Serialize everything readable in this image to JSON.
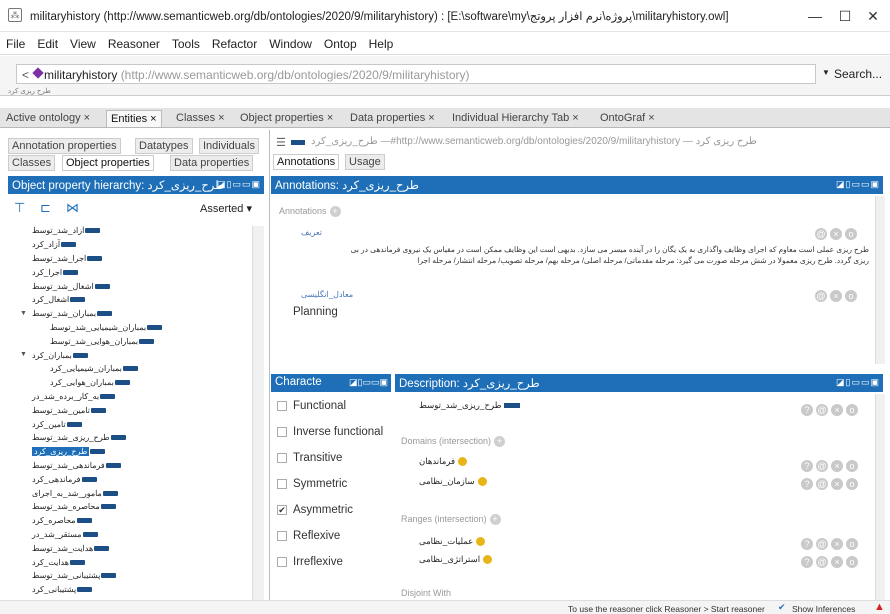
{
  "window": {
    "title": "militaryhistory (http://www.semanticweb.org/db/ontologies/2020/9/militaryhistory) : [E:\\software\\my\\پروژه\\نرم افزار پروتج\\militaryhistory.owl]",
    "minimize": "—",
    "maximize": "☐",
    "close": "✕"
  },
  "menu": [
    "File",
    "Edit",
    "View",
    "Reasoner",
    "Tools",
    "Refactor",
    "Window",
    "Ontop",
    "Help"
  ],
  "address": {
    "back": "<",
    "name": "militaryhistory",
    "iri": "(http://www.semanticweb.org/db/ontologies/2020/9/militaryhistory)",
    "search": "Search...",
    "breadcrumb": "طرح ریزی کرد"
  },
  "main_tabs": [
    "Active ontology ×",
    "Entities ×",
    "Classes ×",
    "Object properties ×",
    "Data properties ×",
    "Individual Hierarchy Tab ×",
    "OntoGraf ×"
  ],
  "left": {
    "subtabs_row1": [
      "Annotation properties",
      "Datatypes",
      "Individuals"
    ],
    "subtabs_row2": [
      "Classes",
      "Object properties",
      "Data properties"
    ],
    "header": "Object property hierarchy: طرح_ریزی_کرد",
    "header_buttons": "◪▯▭▭▣",
    "asserted": "Asserted ▾",
    "tree": [
      {
        "indent": 0,
        "label": "آزاد_شد_توسط"
      },
      {
        "indent": 0,
        "label": "آزاد_کرد"
      },
      {
        "indent": 0,
        "label": "اجرا_شد_توسط"
      },
      {
        "indent": 0,
        "label": "اجرا_کرد"
      },
      {
        "indent": 0,
        "label": "اشغال_شد_توسط"
      },
      {
        "indent": 0,
        "label": "اشغال_کرد"
      },
      {
        "indent": 0,
        "label": "بمباران_شد_توسط",
        "expanded": true
      },
      {
        "indent": 1,
        "label": "بمباران_شیمیایی_شد_توسط"
      },
      {
        "indent": 1,
        "label": "بمباران_هوایی_شد_توسط"
      },
      {
        "indent": 0,
        "label": "بمباران_کرد",
        "expanded": true
      },
      {
        "indent": 1,
        "label": "بمباران_شیمیایی_کرد"
      },
      {
        "indent": 1,
        "label": "بمباران_هوایی_کرد"
      },
      {
        "indent": 0,
        "label": "به_کار_برده_شد_در"
      },
      {
        "indent": 0,
        "label": "تامین_شد_توسط"
      },
      {
        "indent": 0,
        "label": "تامین_کرد"
      },
      {
        "indent": 0,
        "label": "طرح_ریزی_شد_توسط"
      },
      {
        "indent": 0,
        "label": "طرح_ریزی_کرد",
        "selected": true
      },
      {
        "indent": 0,
        "label": "فرماندهی_شد_توسط"
      },
      {
        "indent": 0,
        "label": "فرماندهی_کرد"
      },
      {
        "indent": 0,
        "label": "مامور_شد_به_اجرای"
      },
      {
        "indent": 0,
        "label": "محاصره_شد_توسط"
      },
      {
        "indent": 0,
        "label": "محاصره_کرد"
      },
      {
        "indent": 0,
        "label": "مستقر_شد_در"
      },
      {
        "indent": 0,
        "label": "هدایت_شد_توسط"
      },
      {
        "indent": 0,
        "label": "هدایت_کرد"
      },
      {
        "indent": 0,
        "label": "پشتیبانی_شد_توسط"
      },
      {
        "indent": 0,
        "label": "پشتیبانی_کرد"
      }
    ]
  },
  "right": {
    "iri_line": "طرح_ریزی_کرد —#http://www.semanticweb.org/db/ontologies/2020/9/militaryhistory — طرح ریزی کرد",
    "tabs": [
      "Annotations",
      "Usage"
    ],
    "annotations_header": "Annotations: طرح_ریزی_کرد",
    "header_buttons": "◪▯▭▭▣",
    "annotations_label": "Annotations",
    "ann1_prop": "تعریف",
    "ann1_text_line1": "طرح ریزی عملی است معاوم که اجرای وظایف واگذاری به یک یگان را در آینده میسر می سازد. بدیهی است این وظایف ممکن است در مقیاس یک نیروی فرماندهی در بی",
    "ann1_text_line2": "ریزی گردد. طرح ریزی معمولا در شش مرحله صورت می گیرد: مرحله مقدماتی/ مرحله اصلی/ مرحله بهم/ مرحله تصویب/ مرحله انتشار/ مرحله اجرا",
    "ann2_prop": "معادل_انگلیسی",
    "ann2_value": "Planning",
    "char_header": "Characte",
    "char_buttons": "◪▯▭▭▣",
    "characteristics": [
      {
        "label": "Functional",
        "checked": false
      },
      {
        "label": "Inverse functional",
        "checked": false
      },
      {
        "label": "Transitive",
        "checked": false
      },
      {
        "label": "Symmetric",
        "checked": false
      },
      {
        "label": "Asymmetric",
        "checked": true
      },
      {
        "label": "Reflexive",
        "checked": false
      },
      {
        "label": "Irreflexive",
        "checked": false
      }
    ],
    "desc_header": "Description: طرح_ریزی_کرد",
    "desc_buttons": "◪▯▭▭▣",
    "inverse": "طرح_ریزی_شد_توسط",
    "domains_label": "Domains (intersection)",
    "domains": [
      "فرماندهان",
      "سازمان_نظامی"
    ],
    "ranges_label": "Ranges (intersection)",
    "ranges": [
      "عملیات_نظامی",
      "استراتژی_نظامی"
    ],
    "disjoint_label": "Disjoint With"
  },
  "status": {
    "message": "To use the reasoner click Reasoner > Start reasoner",
    "show_inferences": "Show Inferences",
    "checkmark": "✔",
    "warning": "▲"
  },
  "colors": {
    "accent": "#1e6fb8",
    "pill": "#1b4f86",
    "class_dot": "#e8b518",
    "warning": "#d62020"
  }
}
